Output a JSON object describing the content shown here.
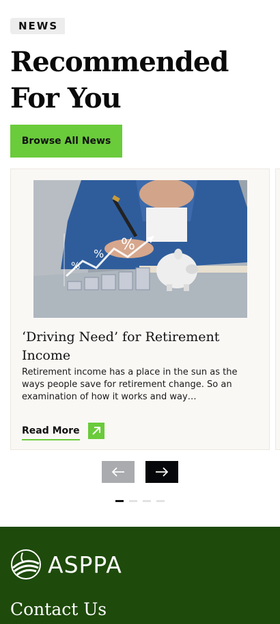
{
  "section": {
    "tag": "NEWS",
    "title": "Recommended For You",
    "browse_label": "Browse All News"
  },
  "articles": [
    {
      "title": "‘Driving Need’ for Retirement Income",
      "excerpt": "Retirement income has a place in the sun as the ways people save for retirement change. So an examination of how it works and way…",
      "read_more_label": "Read More",
      "image_icon": "retirement-savings-photo"
    }
  ],
  "carousel": {
    "prev_icon": "arrow-left-icon",
    "next_icon": "arrow-right-icon",
    "page_count": 4,
    "active_page": 1
  },
  "footer": {
    "logo_text": "ASPPA",
    "contact_label": "Contact Us"
  },
  "colors": {
    "accent_green": "#6acb3b",
    "footer_green": "#1e4a0b",
    "card_bg": "#faf8f5",
    "nav_prev_bg": "#a9abae",
    "nav_next_bg": "#05070a"
  }
}
